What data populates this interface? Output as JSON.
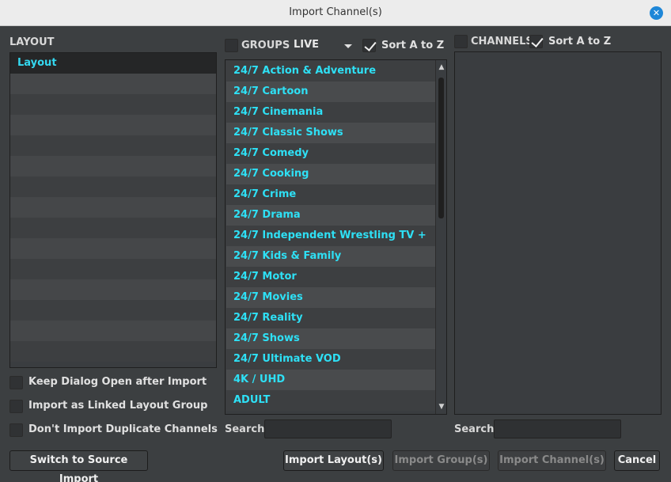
{
  "window": {
    "title": "Import Channel(s)",
    "close_icon": "close-icon"
  },
  "layout": {
    "label": "LAYOUT",
    "items": [
      "Layout"
    ]
  },
  "groups": {
    "label": "GROUPS",
    "source_value": "LIVE",
    "sort_label": "Sort A to Z",
    "items": [
      "24/7 Action & Adventure",
      "24/7 Cartoon",
      "24/7 Cinemania",
      "24/7 Classic Shows",
      "24/7 Comedy",
      "24/7 Cooking",
      "24/7 Crime",
      "24/7 Drama",
      "24/7 Independent Wrestling TV +",
      "24/7 Kids & Family",
      "24/7 Motor",
      "24/7 Movies",
      "24/7 Reality",
      "24/7 Shows",
      "24/7 Ultimate VOD",
      "4K / UHD",
      "ADULT"
    ]
  },
  "channels": {
    "label": "CHANNELS",
    "sort_label": "Sort A to Z"
  },
  "options": {
    "keep_open": "Keep Dialog Open after Import",
    "linked_group": "Import as Linked Layout Group",
    "no_duplicates": "Don't Import Duplicate Channels"
  },
  "search": {
    "label": "Search",
    "groups_value": "",
    "channels_value": ""
  },
  "buttons": {
    "switch_source": "Switch to Source Import",
    "import_layouts": "Import Layout(s)",
    "import_groups": "Import Group(s)",
    "import_channels": "Import Channel(s)",
    "cancel": "Cancel"
  },
  "colors": {
    "accent_text": "#2ee0f5",
    "close_button": "#1e87d8"
  }
}
